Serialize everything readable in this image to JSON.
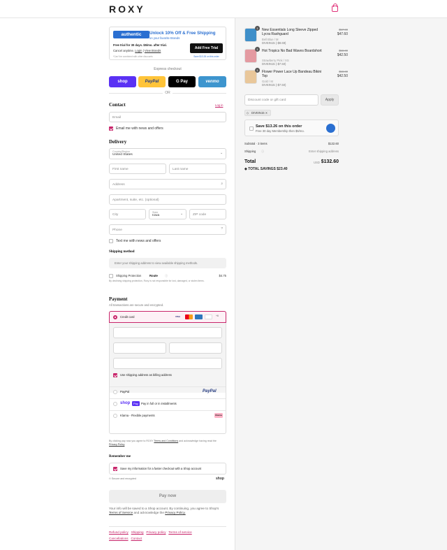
{
  "header": {
    "logo": "ROXY"
  },
  "promo": {
    "brand": "authentic",
    "headline": "Unlock 10% Off & Free Shipping",
    "subline": "on your favorite Brands",
    "trial": "Free trial for 30 days. $5/mo. after trial.",
    "cancel_text": "Cancel anytime.",
    "login": "Login",
    "view_brands": "View Brands",
    "note": "*Can't be combined with other discounts",
    "cta": "Add Free Trial",
    "cta_note": "Save $13.26 on this order"
  },
  "express": {
    "title": "Express checkout",
    "shop": "shop",
    "paypal": "PayPal",
    "gpay": "G Pay",
    "venmo": "venmo",
    "or": "OR"
  },
  "contact": {
    "title": "Contact",
    "login": "Log in",
    "email_placeholder": "Email",
    "news_label": "Email me with news and offers"
  },
  "delivery": {
    "title": "Delivery",
    "country_label": "Country/Region",
    "country_value": "United States",
    "first_name": "First name",
    "last_name": "Last name",
    "address": "Address",
    "apartment": "Apartment, suite, etc. (optional)",
    "city": "City",
    "state_label": "State",
    "state_value": "Iowa",
    "zip": "ZIP code",
    "phone": "Phone",
    "text_label": "Text me with news and offers"
  },
  "shipping": {
    "title": "Shipping method",
    "placeholder": "Enter your shipping address to view available shipping methods.",
    "protection": "Shipping Protection",
    "route": "Route",
    "protection_price": "$4.75",
    "disclaimer": "By declining shipping protection, Roxy is not responsible for lost, damaged, or stolen items."
  },
  "payment": {
    "title": "Payment",
    "subtitle": "All transactions are secure and encrypted.",
    "credit_card": "Credit card",
    "billing_label": "Use shipping address as billing address",
    "paypal": "PayPal",
    "shop_pay": "shop",
    "shop_pay_pill": "Pay",
    "shop_pay_text": "Pay in full or in installments",
    "klarna": "Klarna - Flexible payments",
    "klarna_badge": "Klarna",
    "card_brands": [
      "VISA",
      "MC",
      "AMEX",
      "DISC",
      "+6"
    ]
  },
  "legal": {
    "text_a": "By clicking pay now you agree to ROXY",
    "terms": "Terms and Conditions",
    "text_b": "and acknowledge having read the",
    "privacy": "Privacy Policy"
  },
  "remember": {
    "title": "Remember me",
    "label": "Save my information for a faster checkout with a Shop account",
    "secure": "Secure and encrypted",
    "shop": "shop"
  },
  "pay_now": "Pay now",
  "shop_note": {
    "text_a": "Your info will be saved to a Shop account. By continuing, you agree to Shop's",
    "terms": "Terms of Service",
    "text_b": "and acknowledge the",
    "privacy": "Privacy Policy."
  },
  "footer": {
    "links": [
      "Refund policy",
      "Shipping",
      "Privacy policy",
      "Terms of service",
      "Cancellations",
      "Contact"
    ]
  },
  "cart": {
    "items": [
      {
        "qty": "1",
        "name": "New Essentials Long Sleeve Zipped Lycra Rashguard",
        "variant": "Bell Blue / M",
        "discount": "DIVEIN15 (-$8.69)",
        "old_price": "$57.90",
        "price": "$47.60",
        "color": "#3f8fc9"
      },
      {
        "qty": "1",
        "name": "Hot Tropics No Bad Waves Boardshort",
        "variant": "Strawberry Pink / XS",
        "discount": "DIVEIN15 (-$7.50)",
        "old_price": "$50.00",
        "price": "$42.50",
        "color": "#e49aa1"
      },
      {
        "qty": "1",
        "name": "Flower Power Lace Up Bandeau Bikini Top",
        "variant": "Gold / M",
        "discount": "DIVEIN15 (-$7.50)",
        "old_price": "$50.00",
        "price": "$42.50",
        "color": "#e9c79a"
      }
    ],
    "discount_placeholder": "Discount code or gift card",
    "apply": "Apply",
    "code_tag": "DIVEIN15",
    "membership_title": "Save $13.26 on this order",
    "membership_sub": "Free 30 day Membership then $5/mo.",
    "subtotal_label": "Subtotal · 3 items",
    "subtotal_value": "$132.60",
    "shipping_label": "Shipping",
    "shipping_value": "Enter shipping address",
    "total_label": "Total",
    "currency": "USD",
    "total_value": "$132.60",
    "savings": "TOTAL SAVINGS  $23.40"
  }
}
